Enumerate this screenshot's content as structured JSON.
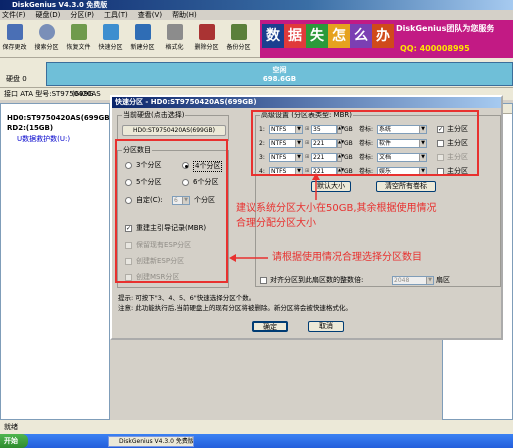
{
  "app": {
    "title": "DiskGenius V4.3.0 免费版",
    "menu": [
      "文件(F)",
      "硬盘(D)",
      "分区(P)",
      "工具(T)",
      "查看(V)",
      "帮助(H)"
    ],
    "toolbar": [
      "保存更改",
      "搜索分区",
      "恢复文件",
      "快速分区",
      "新建分区",
      "格式化",
      "删除分区",
      "备份分区"
    ],
    "banner": {
      "chars": [
        "数",
        "据",
        "失",
        "怎",
        "么",
        "办"
      ],
      "line1": "DiskGenius团队为您服务",
      "line2": "QQ: 400008995"
    },
    "disk_label": "硬盘 0",
    "disk_block": {
      "name": "空闲",
      "size": "698.6GB"
    },
    "info_prefix": "接口 ATA  型号:ST9750420AS",
    "info_trailing": "(699G",
    "tree": [
      "HD0:ST9750420AS(699GB",
      "RD2:(15GB)",
      "U数据救护数(U:)"
    ],
    "right_header": "容量",
    "status": "就绪",
    "taskbar": {
      "start": "开始",
      "item": "DiskGenius V4.3.0 免费版"
    }
  },
  "dialog": {
    "title": "快速分区 - HD0:ST9750420AS(699GB)",
    "current_disk_label": "当前硬盘(点击选择)",
    "current_disk_value": "HD0:ST9750420AS(699GB)",
    "count_group_label": "分区数目",
    "counts": [
      "3个分区",
      "4个分区",
      "5个分区",
      "6个分区"
    ],
    "custom_label": "自定(C):",
    "custom_value": "6",
    "custom_unit": "个分区",
    "rebuild_mbr": "重建主引导记录(MBR)",
    "disabled_options": [
      "保留现有ESP分区",
      "创建新ESP分区",
      "创建MSR分区"
    ],
    "advanced_label": "高级设置 (分区表类型: MBR)",
    "rows": [
      {
        "idx": "1:",
        "fs": "NTFS",
        "size": "35",
        "unit": "GB",
        "vol_label": "卷标:",
        "vol": "系统",
        "primary": "主分区",
        "primary_checked": true,
        "primary_enabled": true
      },
      {
        "idx": "2:",
        "fs": "NTFS",
        "size": "221",
        "unit": "GB",
        "vol_label": "卷标:",
        "vol": "软件",
        "primary": "主分区",
        "primary_checked": false,
        "primary_enabled": true
      },
      {
        "idx": "3:",
        "fs": "NTFS",
        "size": "221",
        "unit": "GB",
        "vol_label": "卷标:",
        "vol": "文档",
        "primary": "主分区",
        "primary_checked": false,
        "primary_enabled": false
      },
      {
        "idx": "4:",
        "fs": "NTFS",
        "size": "221",
        "unit": "GB",
        "vol_label": "卷标:",
        "vol": "娱乐",
        "primary": "主分区",
        "primary_checked": false,
        "primary_enabled": true
      }
    ],
    "default_size_button": "默认大小",
    "clear_labels_button": "清空所有卷标",
    "align_label": "对齐分区到此扇区数的整数倍:",
    "align_value": "2048",
    "align_unit": "扇区",
    "tip_line1": "提示: 可按下\"3、4、5、6\"快速选择分区个数。",
    "tip_line2": "注意: 此功能执行后,当前硬盘上的现有分区将被删除。新分区将会被快速格式化。",
    "ok_button": "确定",
    "cancel_button": "取消"
  },
  "annotations": {
    "size_note_line1": "建议系统分区大小在50GB,其余根据使用情况",
    "size_note_line2": "合理分配分区大小",
    "count_note": "请根据使用情况合理选择分区数目"
  },
  "colors": {
    "annotation": "#e8312f",
    "titlebar": "#0a246a",
    "disk_free": "#6fbfd8",
    "banner": "#c21a84"
  }
}
